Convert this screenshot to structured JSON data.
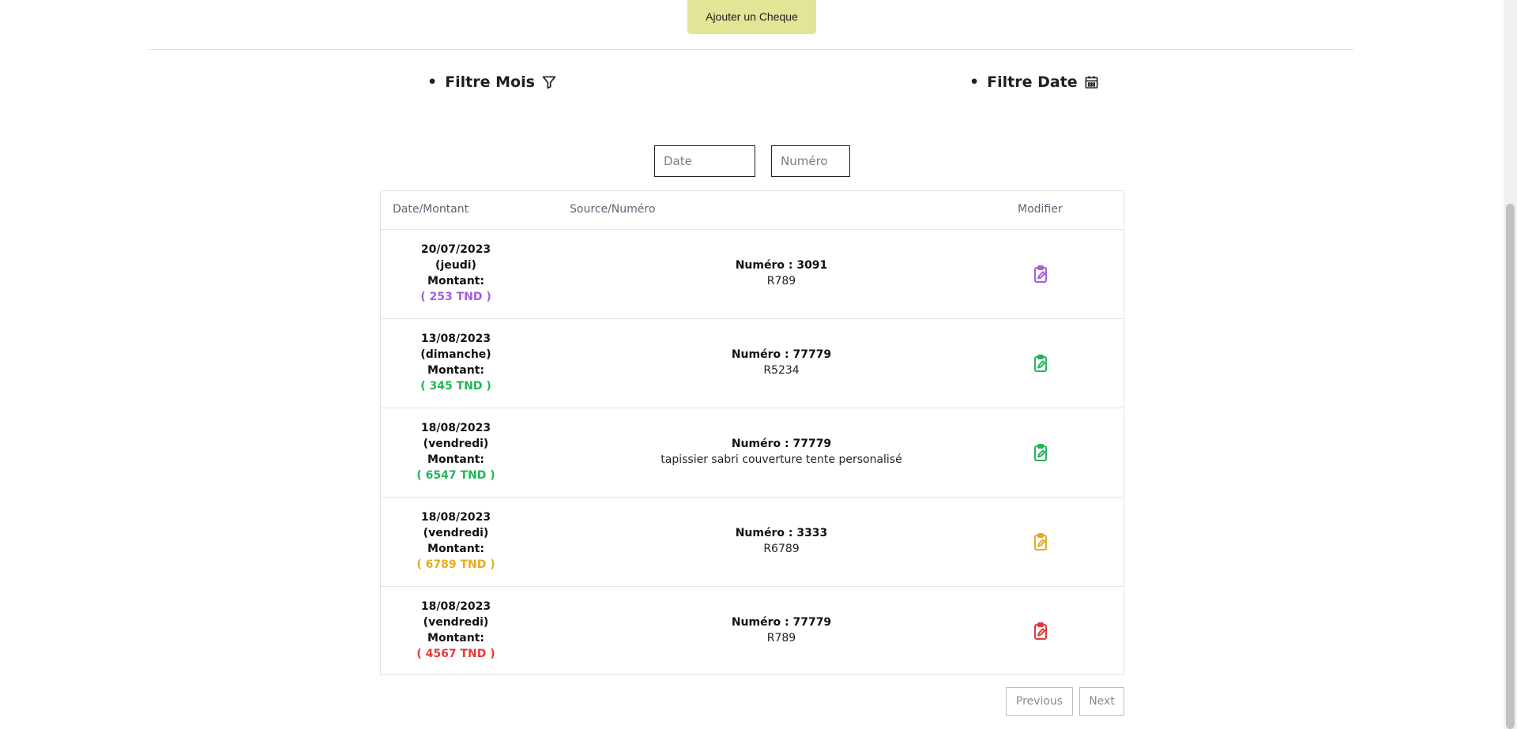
{
  "toolbar": {
    "add_label": "Ajouter un Cheque"
  },
  "filters": {
    "mois_label": "Filtre Mois",
    "date_label": "Filtre Date",
    "bullet": "•"
  },
  "search": {
    "date_placeholder": "Date",
    "numero_placeholder": "Numéro"
  },
  "table": {
    "headers": {
      "date": "Date/Montant",
      "source": "Source/Numéro",
      "modify": "Modifier"
    },
    "rows": [
      {
        "date": "20/07/2023",
        "day": "(jeudi)",
        "montant_label": "Montant:",
        "amount": "( 253 TND )",
        "color": "#a35de0",
        "numero": "Numéro : 3091",
        "source": "R789"
      },
      {
        "date": "13/08/2023",
        "day": "(dimanche)",
        "montant_label": "Montant:",
        "amount": "( 345 TND )",
        "color": "#25b35a",
        "numero": "Numéro : 77779",
        "source": "R5234"
      },
      {
        "date": "18/08/2023",
        "day": "(vendredi)",
        "montant_label": "Montant:",
        "amount": "( 6547 TND )",
        "color": "#25b35a",
        "numero": "Numéro : 77779",
        "source": "tapissier sabri couverture tente personalisé"
      },
      {
        "date": "18/08/2023",
        "day": "(vendredi)",
        "montant_label": "Montant:",
        "amount": "( 6789 TND )",
        "color": "#e6ac1e",
        "numero": "Numéro : 3333",
        "source": "R6789"
      },
      {
        "date": "18/08/2023",
        "day": "(vendredi)",
        "montant_label": "Montant:",
        "amount": "( 4567 TND )",
        "color": "#e23b3b",
        "numero": "Numéro : 77779",
        "source": "R789"
      }
    ]
  },
  "pagination": {
    "previous": "Previous",
    "next": "Next"
  },
  "icons": {
    "filter": "filter-icon",
    "calendar": "calendar-icon",
    "edit": "clipboard-edit-icon"
  }
}
